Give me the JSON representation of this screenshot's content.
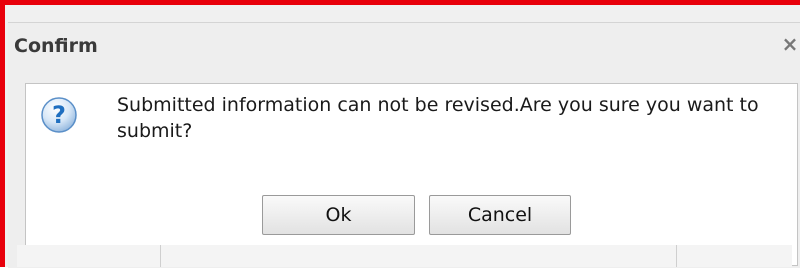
{
  "dialog": {
    "title": "Confirm",
    "close_symbol": "×",
    "message": "Submitted information can not be revised.Are you sure you want to submit?",
    "icon": "question-icon",
    "buttons": {
      "ok_label": "Ok",
      "cancel_label": "Cancel"
    }
  },
  "colors": {
    "highlight_border": "#e8000b",
    "icon_blue": "#1f6fc0"
  }
}
